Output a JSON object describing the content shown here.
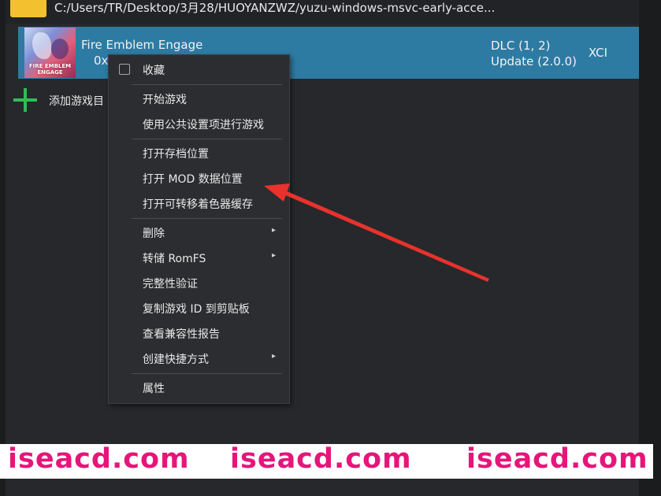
{
  "path_row": {
    "folder_icon": "folder-icon",
    "path": "C:/Users/TR/Desktop/3月28/HUOYANZWZ/yuzu-windows-msvc-early-acce..."
  },
  "game": {
    "cover_logo": "FIRE EMBLEM ENGAGE",
    "title": "Fire Emblem Engage",
    "id": "0x",
    "addons": {
      "dlc": "DLC (1, 2)",
      "update": "Update (2.0.0)"
    },
    "file_type": "XCI"
  },
  "add_directory": {
    "icon": "plus-icon",
    "label": "添加游戏目"
  },
  "context_menu": {
    "favorite": "收藏",
    "start_game": "开始游戏",
    "start_global": "使用公共设置项进行游戏",
    "open_save": "打开存档位置",
    "open_mod": "打开 MOD 数据位置",
    "open_shader": "打开可转移着色器缓存",
    "remove": "删除",
    "dump_romfs": "转储 RomFS",
    "verify": "完整性验证",
    "copy_id": "复制游戏 ID 到剪贴板",
    "compat_report": "查看兼容性报告",
    "create_shortcut": "创建快捷方式",
    "properties": "属性",
    "submenu_arrow": "▸"
  },
  "annotation": {
    "arrow_color": "#e8322c"
  },
  "watermark": {
    "text_1": "iseacd.com",
    "text_2": "iseacd.com",
    "text_3": "iseacd.com",
    "color": "#e6157a"
  }
}
